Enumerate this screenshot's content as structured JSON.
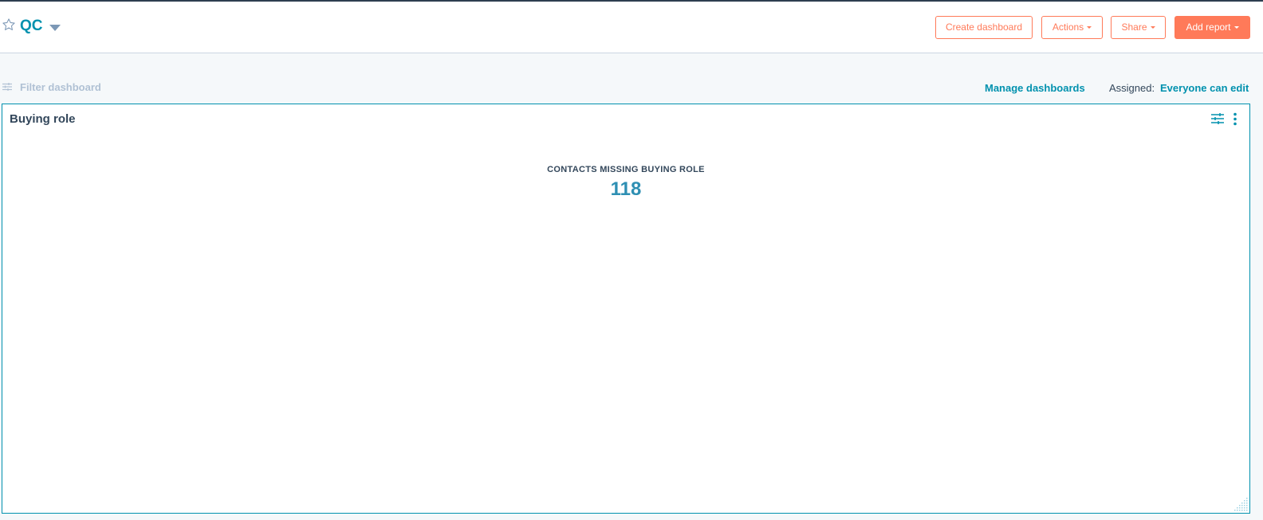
{
  "header": {
    "title": "QC",
    "buttons": {
      "create_dashboard": "Create dashboard",
      "actions": "Actions",
      "share": "Share",
      "add_report": "Add report"
    }
  },
  "toolbar": {
    "filter_label": "Filter dashboard",
    "manage_dashboards": "Manage dashboards",
    "assigned_label": "Assigned:",
    "assigned_value": "Everyone can edit"
  },
  "report": {
    "title": "Buying role",
    "metric_label": "CONTACTS MISSING BUYING ROLE",
    "metric_value": "118"
  },
  "icons": {
    "favorite": "star-icon",
    "title_dropdown": "caret-down-icon",
    "filter": "sliders-icon",
    "more": "vertical-ellipsis-icon",
    "resize": "resize-grip-icon"
  },
  "colors": {
    "accent": "#0091ae",
    "brand_orange": "#ff7a59",
    "text": "#33475b",
    "background": "#f5f8fa"
  }
}
